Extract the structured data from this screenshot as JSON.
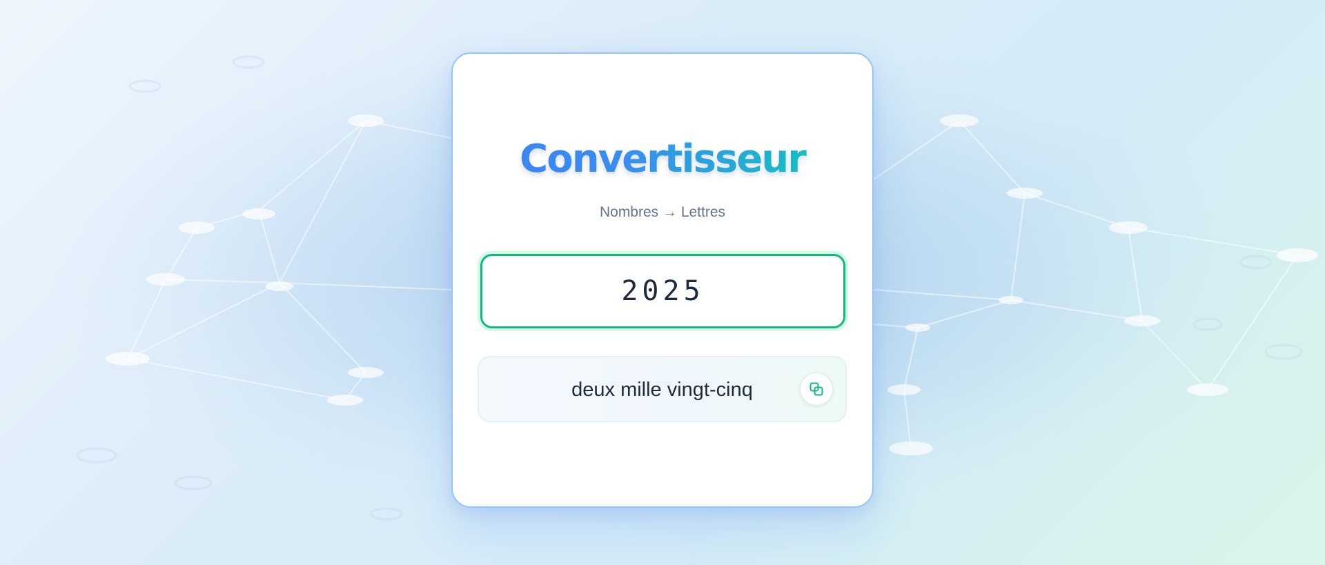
{
  "app": {
    "title": "Convertisseur",
    "subtitle": "Nombres → Lettres"
  },
  "input": {
    "value": "2025"
  },
  "result": {
    "text": "deux mille vingt-cinq"
  },
  "icons": {
    "copy": "copy-icon"
  },
  "colors": {
    "accent_blue": "#3b82f6",
    "accent_teal": "#18c4a8",
    "input_border": "#10b981",
    "card_border": "#93c5fd"
  }
}
